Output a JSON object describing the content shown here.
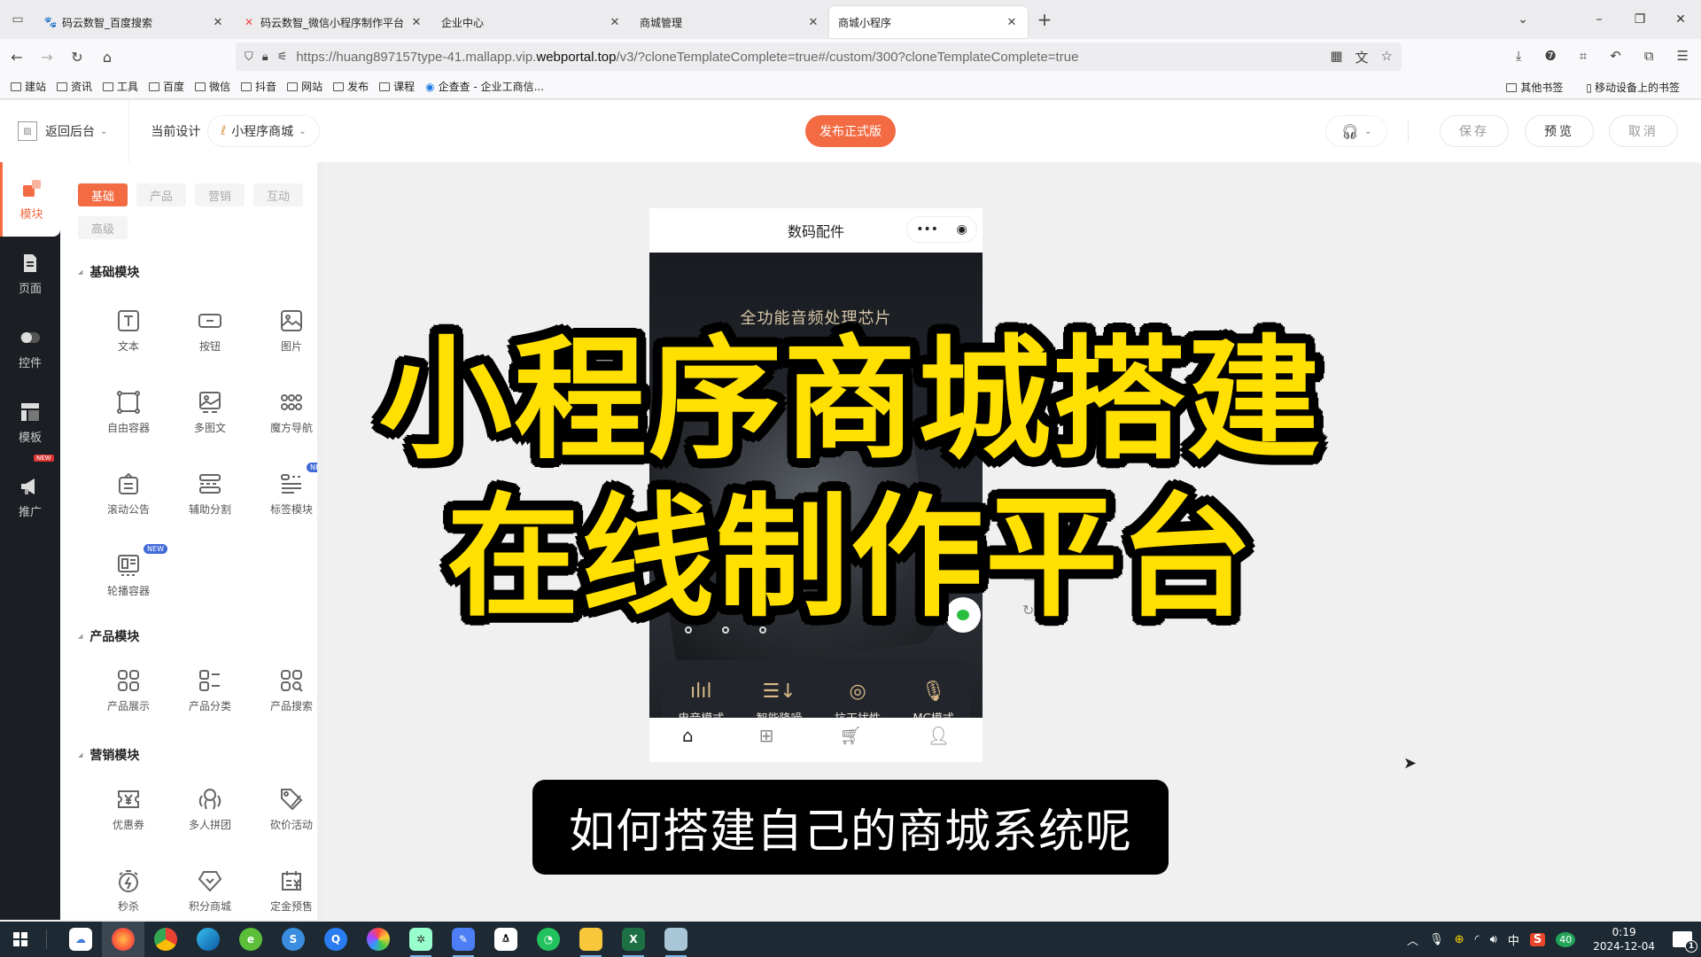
{
  "browser": {
    "tabs": [
      {
        "title": "码云数智_百度搜索",
        "icon": "baidu-paw-icon",
        "active": false
      },
      {
        "title": "码云数智_微信小程序制作平台",
        "icon": "mayun-logo-icon",
        "active": false
      },
      {
        "title": "企业中心",
        "icon": "",
        "active": false
      },
      {
        "title": "商城管理",
        "icon": "",
        "active": false
      },
      {
        "title": "商城小程序",
        "icon": "",
        "active": true
      }
    ],
    "url_prefix": "https://huang897157type-41.mallapp.vip.",
    "url_domain": "webportal.top",
    "url_suffix": "/v3/?cloneTemplateComplete=true#/custom/300?cloneTemplateComplete=true",
    "bookmarks": [
      "建站",
      "资讯",
      "工具",
      "百度",
      "微信",
      "抖音",
      "网站",
      "发布",
      "课程"
    ],
    "bookmark_special": "企查查 - 企业工商信...",
    "bookmarks_right": [
      "其他书签",
      "移动设备上的书签"
    ]
  },
  "header": {
    "back_label": "返回后台",
    "current_design_label": "当前设计",
    "design_name": "小程序商城",
    "publish_label": "发布正式版",
    "save_label": "保存",
    "preview_label": "预览",
    "cancel_label": "取消"
  },
  "rail": {
    "items": [
      {
        "label": "模块",
        "icon": "module-icon",
        "active": true
      },
      {
        "label": "页面",
        "icon": "page-icon",
        "active": false
      },
      {
        "label": "控件",
        "icon": "toggle-icon",
        "active": false
      },
      {
        "label": "模板",
        "icon": "template-icon",
        "active": false
      },
      {
        "label": "推广",
        "icon": "megaphone-icon",
        "active": false,
        "badge": "NEW"
      }
    ]
  },
  "panel": {
    "category_tabs": [
      {
        "label": "基础",
        "active": true
      },
      {
        "label": "产品",
        "active": false
      },
      {
        "label": "营销",
        "active": false
      },
      {
        "label": "互动",
        "active": false
      },
      {
        "label": "高级",
        "active": false
      }
    ],
    "sections": [
      {
        "title": "基础模块",
        "items": [
          {
            "label": "文本",
            "icon": "text-icon"
          },
          {
            "label": "按钮",
            "icon": "button-icon"
          },
          {
            "label": "图片",
            "icon": "image-icon"
          },
          {
            "label": "自由容器",
            "icon": "free-container-icon"
          },
          {
            "label": "多图文",
            "icon": "multi-image-icon"
          },
          {
            "label": "魔方导航",
            "icon": "grid-nav-icon"
          },
          {
            "label": "滚动公告",
            "icon": "notice-icon"
          },
          {
            "label": "辅助分割",
            "icon": "divider-icon"
          },
          {
            "label": "标签模块",
            "icon": "tag-module-icon",
            "badge": "NEW"
          },
          {
            "label": "轮播容器",
            "icon": "carousel-icon",
            "badge": "NEW"
          }
        ]
      },
      {
        "title": "产品模块",
        "items": [
          {
            "label": "产品展示",
            "icon": "product-grid-icon"
          },
          {
            "label": "产品分类",
            "icon": "product-category-icon"
          },
          {
            "label": "产品搜索",
            "icon": "product-search-icon"
          }
        ]
      },
      {
        "title": "营销模块",
        "items": [
          {
            "label": "优惠券",
            "icon": "coupon-icon"
          },
          {
            "label": "多人拼团",
            "icon": "group-buy-icon"
          },
          {
            "label": "砍价活动",
            "icon": "bargain-icon"
          },
          {
            "label": "秒杀",
            "icon": "flash-sale-icon"
          },
          {
            "label": "积分商城",
            "icon": "points-mall-icon"
          },
          {
            "label": "定金预售",
            "icon": "presale-icon"
          }
        ]
      }
    ]
  },
  "phone": {
    "title": "数码配件",
    "banner_text": "全功能音频处理芯片",
    "features": [
      {
        "label": "电音模式",
        "icon": "equalizer-icon"
      },
      {
        "label": "智能降噪",
        "icon": "noise-reduce-icon"
      },
      {
        "label": "抗干扰性",
        "icon": "signal-icon"
      },
      {
        "label": "MC模式",
        "icon": "microphone-icon"
      }
    ],
    "nav": [
      "home-icon",
      "category-icon",
      "cart-icon",
      "user-icon"
    ]
  },
  "overlay": {
    "title_line1": "小程序商城搭建",
    "title_line2": "在线制作平台",
    "subtitle": "如何搭建自己的商城系统呢"
  },
  "taskbar": {
    "apps": [
      "baidu-netdisk",
      "firefox",
      "chrome",
      "edge",
      "360-browser",
      "sogou-browser",
      "quark",
      "photos",
      "settings",
      "feishu",
      "qq",
      "wechat",
      "file-explorer",
      "excel",
      "notepad"
    ],
    "tray_ime": "中",
    "tray_badge": "40",
    "time": "0:19",
    "date": "2024-12-04",
    "notifications": "1"
  },
  "colors": {
    "accent": "#f26b43",
    "rail_bg": "#1b1f23",
    "title_yellow": "#ffe000"
  }
}
